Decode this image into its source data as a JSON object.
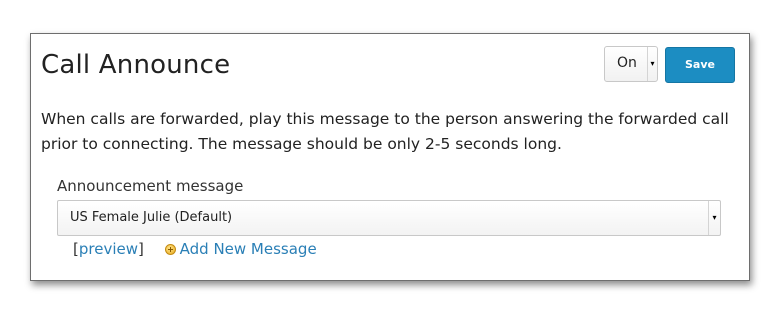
{
  "panel": {
    "title": "Call Announce",
    "state_select": {
      "value": "On"
    },
    "save_label": "Save",
    "description": "When calls are forwarded, play this message to the person answering the forwarded call prior to connecting. The message should be only 2-5 seconds long."
  },
  "announcement": {
    "label": "Announcement message",
    "selected": "US Female Julie (Default)"
  },
  "links": {
    "bracket_open": "[",
    "preview": "preview",
    "bracket_close": "]",
    "add_new": "Add New Message"
  },
  "icons": {
    "dropdown_arrow": "▾",
    "add": "plus-circle-icon"
  },
  "colors": {
    "accent": "#1c8dc2",
    "link": "#2a7fb6",
    "text": "#222222"
  }
}
